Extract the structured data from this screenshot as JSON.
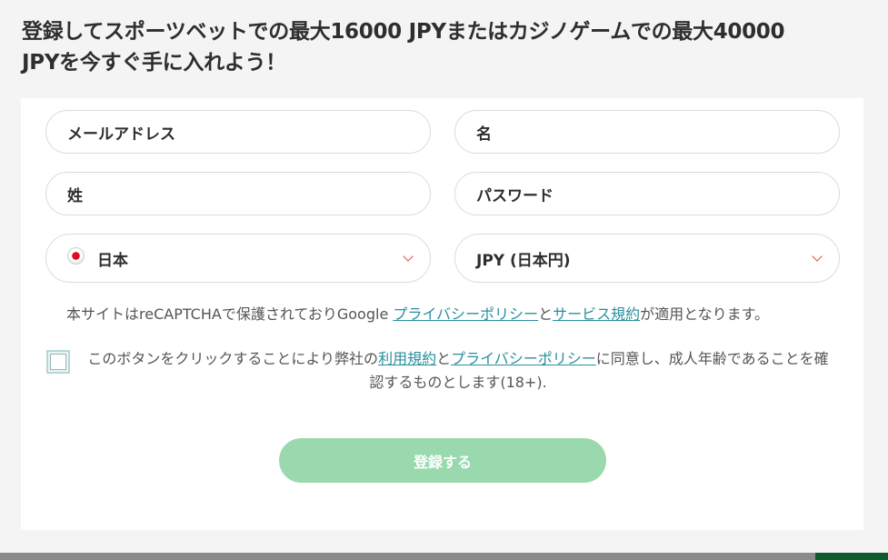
{
  "headline": {
    "line1": "登録してスポーツベットでの最大16000 JPYまたはカジノゲームでの最大40000",
    "line2": "JPYを今すぐ手に入れよう！"
  },
  "form": {
    "email_placeholder": "メールアドレス",
    "first_name_placeholder": "名",
    "last_name_placeholder": "姓",
    "password_placeholder": "パスワード",
    "country_value": "日本",
    "currency_value": "JPY (日本円)"
  },
  "recaptcha": {
    "prefix": "本サイトはreCAPTCHAで保護されておりGoogle ",
    "privacy_link": "プライバシーポリシー",
    "and": "と",
    "terms_link": "サービス規約",
    "suffix": "が適用となります。"
  },
  "consent": {
    "prefix": "このボタンをクリックすることにより弊社の",
    "terms_link": "利用規約",
    "and": "と",
    "privacy_link": "プライバシーポリシー",
    "suffix": "に同意し、成人年齢であることを確認するものとします(18+)."
  },
  "submit_label": "登録する",
  "icons": {
    "country": "japan-flag-icon",
    "dropdown": "chevron-down-icon"
  },
  "colors": {
    "link": "#2a8f9e",
    "submit_bg": "#99d9ad",
    "chevron": "#e04b3a"
  }
}
